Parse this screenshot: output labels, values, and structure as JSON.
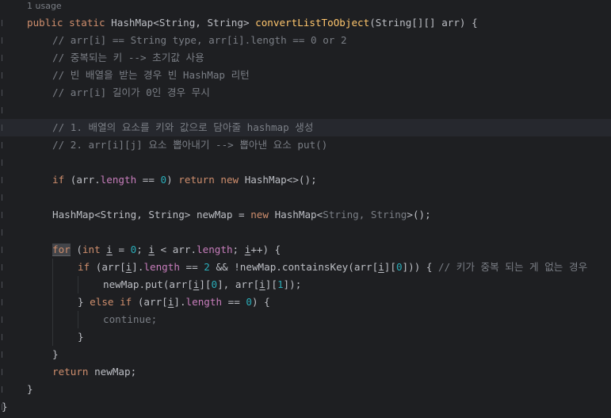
{
  "editor": {
    "usage_hint": "1 usage",
    "lines": [
      {
        "indent": 0,
        "tokens": [
          {
            "t": "public ",
            "c": "kw"
          },
          {
            "t": "static ",
            "c": "kw"
          },
          {
            "t": "HashMap<String, String> ",
            "c": "pl"
          },
          {
            "t": "convertListToObject",
            "c": "fn"
          },
          {
            "t": "(String[][] arr) {",
            "c": "pl"
          }
        ]
      },
      {
        "indent": 1,
        "tokens": [
          {
            "t": "// arr[i] == String type, arr[i].length == 0 or 2",
            "c": "cm"
          }
        ]
      },
      {
        "indent": 1,
        "tokens": [
          {
            "t": "// 중복되는 키 --> 초기값 사용",
            "c": "cm"
          }
        ]
      },
      {
        "indent": 1,
        "tokens": [
          {
            "t": "// 빈 배열을 받는 경우 빈 HashMap 리턴",
            "c": "cm"
          }
        ]
      },
      {
        "indent": 1,
        "tokens": [
          {
            "t": "// arr[i] 길이가 0인 경우 무시",
            "c": "cm"
          }
        ]
      },
      {
        "indent": 1,
        "tokens": []
      },
      {
        "indent": 1,
        "current": true,
        "tokens": [
          {
            "t": "// 1. 배열의 요소를 키와 값으로 담아줄 hashmap 생성",
            "c": "cm"
          }
        ]
      },
      {
        "indent": 1,
        "tokens": [
          {
            "t": "// 2. arr[i][j] 요소 뽑아내기 --> 뽑아낸 요소 put()",
            "c": "cm"
          }
        ]
      },
      {
        "indent": 1,
        "tokens": []
      },
      {
        "indent": 1,
        "tokens": [
          {
            "t": "if ",
            "c": "kw"
          },
          {
            "t": "(arr.",
            "c": "pl"
          },
          {
            "t": "length",
            "c": "fld"
          },
          {
            "t": " == ",
            "c": "pl"
          },
          {
            "t": "0",
            "c": "num"
          },
          {
            "t": ") ",
            "c": "pl"
          },
          {
            "t": "return new ",
            "c": "kw"
          },
          {
            "t": "HashMap<>();",
            "c": "pl"
          }
        ]
      },
      {
        "indent": 1,
        "tokens": []
      },
      {
        "indent": 1,
        "tokens": [
          {
            "t": "HashMap<String, String> newMap = ",
            "c": "pl"
          },
          {
            "t": "new ",
            "c": "kw"
          },
          {
            "t": "HashMap<",
            "c": "pl"
          },
          {
            "t": "String, String",
            "c": "gen"
          },
          {
            "t": ">();",
            "c": "pl"
          }
        ]
      },
      {
        "indent": 1,
        "tokens": []
      },
      {
        "indent": 1,
        "tokens": [
          {
            "t": "for",
            "c": "kw for-hl"
          },
          {
            "t": " (",
            "c": "pl"
          },
          {
            "t": "int ",
            "c": "kw"
          },
          {
            "t": "i",
            "c": "pl ul"
          },
          {
            "t": " = ",
            "c": "pl"
          },
          {
            "t": "0",
            "c": "num"
          },
          {
            "t": "; ",
            "c": "pl"
          },
          {
            "t": "i",
            "c": "pl ul"
          },
          {
            "t": " < arr.",
            "c": "pl"
          },
          {
            "t": "length",
            "c": "fld"
          },
          {
            "t": "; ",
            "c": "pl"
          },
          {
            "t": "i",
            "c": "pl ul"
          },
          {
            "t": "++) {",
            "c": "pl"
          }
        ]
      },
      {
        "indent": 2,
        "tokens": [
          {
            "t": "if ",
            "c": "kw"
          },
          {
            "t": "(arr[",
            "c": "pl"
          },
          {
            "t": "i",
            "c": "pl ul"
          },
          {
            "t": "].",
            "c": "pl"
          },
          {
            "t": "length",
            "c": "fld"
          },
          {
            "t": " == ",
            "c": "pl"
          },
          {
            "t": "2",
            "c": "num"
          },
          {
            "t": " && !newMap.containsKey(arr[",
            "c": "pl"
          },
          {
            "t": "i",
            "c": "pl ul"
          },
          {
            "t": "][",
            "c": "pl"
          },
          {
            "t": "0",
            "c": "num"
          },
          {
            "t": "])) { ",
            "c": "pl"
          },
          {
            "t": "// 키가 중복 되는 게 없는 경우",
            "c": "cm"
          }
        ]
      },
      {
        "indent": 3,
        "tokens": [
          {
            "t": "newMap.put(arr[",
            "c": "pl"
          },
          {
            "t": "i",
            "c": "pl ul"
          },
          {
            "t": "][",
            "c": "pl"
          },
          {
            "t": "0",
            "c": "num"
          },
          {
            "t": "], arr[",
            "c": "pl"
          },
          {
            "t": "i",
            "c": "pl ul"
          },
          {
            "t": "][",
            "c": "pl"
          },
          {
            "t": "1",
            "c": "num"
          },
          {
            "t": "]);",
            "c": "pl"
          }
        ]
      },
      {
        "indent": 2,
        "tokens": [
          {
            "t": "} ",
            "c": "pl"
          },
          {
            "t": "else if ",
            "c": "kw"
          },
          {
            "t": "(arr[",
            "c": "pl"
          },
          {
            "t": "i",
            "c": "pl ul"
          },
          {
            "t": "].",
            "c": "pl"
          },
          {
            "t": "length",
            "c": "fld"
          },
          {
            "t": " == ",
            "c": "pl"
          },
          {
            "t": "0",
            "c": "num"
          },
          {
            "t": ") {",
            "c": "pl"
          }
        ]
      },
      {
        "indent": 3,
        "tokens": [
          {
            "t": "continue;",
            "c": "gen"
          }
        ]
      },
      {
        "indent": 2,
        "tokens": [
          {
            "t": "}",
            "c": "pl"
          }
        ]
      },
      {
        "indent": 1,
        "tokens": [
          {
            "t": "}",
            "c": "pl"
          }
        ]
      },
      {
        "indent": 1,
        "tokens": [
          {
            "t": "return ",
            "c": "kw"
          },
          {
            "t": "newMap;",
            "c": "pl"
          }
        ]
      },
      {
        "indent": 0,
        "tokens": [
          {
            "t": "}",
            "c": "pl"
          }
        ]
      },
      {
        "indent": -1,
        "tokens": [
          {
            "t": "}",
            "c": "pl"
          }
        ]
      }
    ]
  }
}
